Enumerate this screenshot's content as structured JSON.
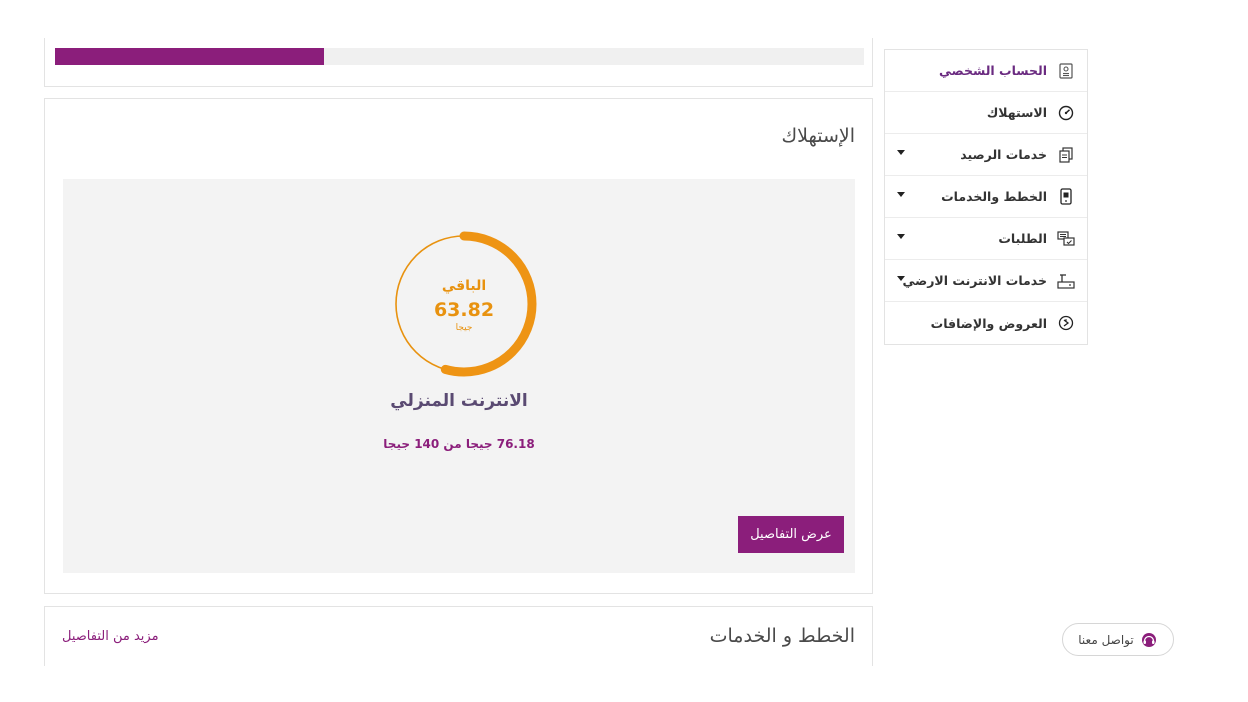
{
  "usage": {
    "title": "الإستهلاك",
    "remaining_label": "الباقي",
    "remaining_value": "63.82",
    "remaining_unit": "جيجا",
    "service_name": "الانترنت المنزلي",
    "detail": "76.18 جيجا من 140 جيجا",
    "details_button": "عرض التفاصيل",
    "used_fraction": 0.5441,
    "colors": {
      "ring": "#e8920f",
      "accent": "#8b1e7b"
    }
  },
  "plans": {
    "title": "الخطط و الخدمات",
    "more_link": "مزيد من التفاصيل"
  },
  "sidebar": {
    "items": [
      {
        "label": "الحساب الشخصي",
        "icon": "id-card-icon",
        "dropdown": false,
        "active": true
      },
      {
        "label": "الاستهلاك",
        "icon": "gauge-icon",
        "dropdown": false,
        "active": false
      },
      {
        "label": "خدمات الرصيد",
        "icon": "documents-icon",
        "dropdown": true,
        "active": false
      },
      {
        "label": "الخطط والخدمات",
        "icon": "mobile-icon",
        "dropdown": true,
        "active": false
      },
      {
        "label": "الطلبات",
        "icon": "chat-icon",
        "dropdown": true,
        "active": false
      },
      {
        "label": "خدمات الانترنت الارضي",
        "icon": "router-icon",
        "dropdown": true,
        "active": false
      },
      {
        "label": "العروض والإضافات",
        "icon": "offer-icon",
        "dropdown": false,
        "active": false
      }
    ]
  },
  "contact": {
    "label": "تواصل معنا",
    "icon": "headset-icon"
  }
}
